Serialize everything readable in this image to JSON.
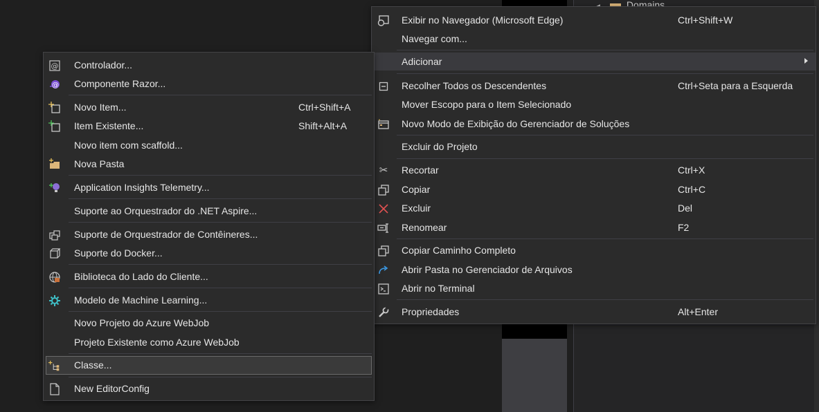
{
  "background": {
    "tree_item_label": "Domains"
  },
  "main_menu": {
    "items": [
      {
        "label": "Exibir no Navegador (Microsoft Edge)",
        "shortcut": "Ctrl+Shift+W",
        "icon": "browser-icon"
      },
      {
        "label": "Navegar com...",
        "shortcut": "",
        "icon": ""
      },
      {
        "label": "Adicionar",
        "shortcut": "",
        "icon": "",
        "submenu": true
      },
      {
        "label": "Recolher Todos os Descendentes",
        "shortcut": "Ctrl+Seta para a Esquerda",
        "icon": "collapse-icon"
      },
      {
        "label": "Mover Escopo para o Item Selecionado",
        "shortcut": "",
        "icon": ""
      },
      {
        "label": "Novo Modo de Exibição do Gerenciador de Soluções",
        "shortcut": "",
        "icon": "new-view-icon"
      },
      {
        "label": "Excluir do Projeto",
        "shortcut": "",
        "icon": ""
      },
      {
        "label": "Recortar",
        "shortcut": "Ctrl+X",
        "icon": "scissors-icon"
      },
      {
        "label": "Copiar",
        "shortcut": "Ctrl+C",
        "icon": "copy-icon"
      },
      {
        "label": "Excluir",
        "shortcut": "Del",
        "icon": "delete-icon"
      },
      {
        "label": "Renomear",
        "shortcut": "F2",
        "icon": "rename-icon"
      },
      {
        "label": "Copiar Caminho Completo",
        "shortcut": "",
        "icon": "copy-path-icon"
      },
      {
        "label": "Abrir Pasta no Gerenciador de Arquivos",
        "shortcut": "",
        "icon": "open-folder-arrow-icon"
      },
      {
        "label": "Abrir no Terminal",
        "shortcut": "",
        "icon": "terminal-icon"
      },
      {
        "label": "Propriedades",
        "shortcut": "Alt+Enter",
        "icon": "wrench-icon"
      }
    ]
  },
  "sub_menu": {
    "items": [
      {
        "label": "Controlador...",
        "shortcut": "",
        "icon": "controller-icon"
      },
      {
        "label": "Componente Razor...",
        "shortcut": "",
        "icon": "razor-icon"
      },
      {
        "label": "Novo Item...",
        "shortcut": "Ctrl+Shift+A",
        "icon": "new-item-icon"
      },
      {
        "label": "Item Existente...",
        "shortcut": "Shift+Alt+A",
        "icon": "existing-item-icon"
      },
      {
        "label": "Novo item com scaffold...",
        "shortcut": "",
        "icon": ""
      },
      {
        "label": "Nova Pasta",
        "shortcut": "",
        "icon": "new-folder-icon"
      },
      {
        "label": "Application Insights Telemetry...",
        "shortcut": "",
        "icon": "insights-icon"
      },
      {
        "label": "Suporte ao Orquestrador do .NET Aspire...",
        "shortcut": "",
        "icon": ""
      },
      {
        "label": "Suporte de Orquestrador de Contêineres...",
        "shortcut": "",
        "icon": "containers-icon"
      },
      {
        "label": "Suporte do Docker...",
        "shortcut": "",
        "icon": "docker-icon"
      },
      {
        "label": "Biblioteca do Lado do Cliente...",
        "shortcut": "",
        "icon": "client-library-icon"
      },
      {
        "label": "Modelo de Machine Learning...",
        "shortcut": "",
        "icon": "ml-model-icon"
      },
      {
        "label": "Novo Projeto do Azure WebJob",
        "shortcut": "",
        "icon": ""
      },
      {
        "label": "Projeto Existente como Azure WebJob",
        "shortcut": "",
        "icon": ""
      },
      {
        "label": "Classe...",
        "shortcut": "",
        "icon": "class-icon",
        "selected": true
      },
      {
        "label": "New EditorConfig",
        "shortcut": "",
        "icon": "file-icon"
      }
    ]
  }
}
